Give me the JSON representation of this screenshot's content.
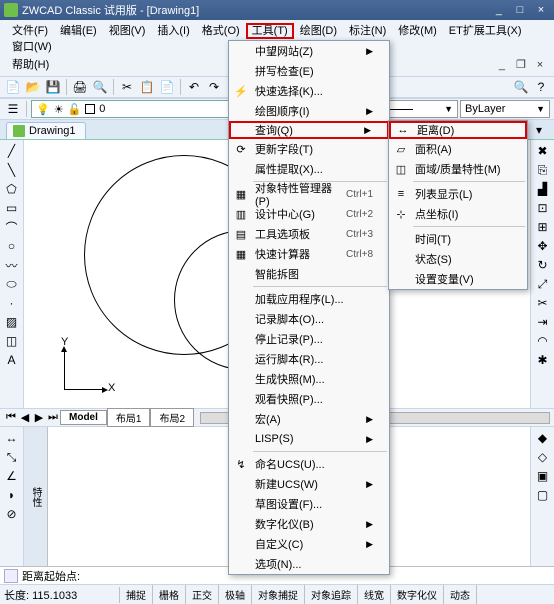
{
  "title": "ZWCAD Classic 试用版 - [Drawing1]",
  "menubar": [
    "文件(F)",
    "编辑(E)",
    "视图(V)",
    "插入(I)",
    "格式(O)",
    "工具(T)",
    "绘图(D)",
    "标注(N)",
    "修改(M)",
    "ET扩展工具(X)",
    "窗口(W)",
    "帮助(H)"
  ],
  "active_menu_index": 5,
  "layer": {
    "name": "0"
  },
  "bylayer": "ByLayer",
  "doctab": "Drawing1",
  "tools_menu": [
    {
      "label": "中望网站(Z)",
      "arrow": true
    },
    {
      "label": "拼写检查(E)"
    },
    {
      "label": "快速选择(K)...",
      "icon": "⚡"
    },
    {
      "label": "绘图顺序(I)",
      "arrow": true
    },
    {
      "label": "查询(Q)",
      "arrow": true,
      "highlight": true
    },
    {
      "label": "更新字段(T)",
      "icon": "⟳"
    },
    {
      "label": "属性提取(X)..."
    },
    {
      "sep": true
    },
    {
      "label": "对象特性管理器(P)",
      "shortcut": "Ctrl+1",
      "icon": "▦"
    },
    {
      "label": "设计中心(G)",
      "shortcut": "Ctrl+2",
      "icon": "▥"
    },
    {
      "label": "工具选项板",
      "shortcut": "Ctrl+3",
      "icon": "▤"
    },
    {
      "label": "快速计算器",
      "shortcut": "Ctrl+8",
      "icon": "▦"
    },
    {
      "label": "智能拆图"
    },
    {
      "sep": true
    },
    {
      "label": "加载应用程序(L)..."
    },
    {
      "label": "记录脚本(O)..."
    },
    {
      "label": "停止记录(P)..."
    },
    {
      "label": "运行脚本(R)..."
    },
    {
      "label": "生成快照(M)..."
    },
    {
      "label": "观看快照(P)..."
    },
    {
      "label": "宏(A)",
      "arrow": true
    },
    {
      "label": "LISP(S)",
      "arrow": true
    },
    {
      "sep": true
    },
    {
      "label": "命名UCS(U)...",
      "icon": "↯"
    },
    {
      "label": "新建UCS(W)",
      "arrow": true
    },
    {
      "label": "草图设置(F)..."
    },
    {
      "label": "数字化仪(B)",
      "arrow": true
    },
    {
      "label": "自定义(C)",
      "arrow": true
    },
    {
      "label": "选项(N)..."
    }
  ],
  "query_submenu": [
    {
      "label": "距离(D)",
      "icon": "↔",
      "highlight": true
    },
    {
      "label": "面积(A)",
      "icon": "▱"
    },
    {
      "label": "面域/质量特性(M)",
      "icon": "◫"
    },
    {
      "sep": true
    },
    {
      "label": "列表显示(L)",
      "icon": "≡"
    },
    {
      "label": "点坐标(I)",
      "icon": "⊹"
    },
    {
      "sep": true
    },
    {
      "label": "时间(T)"
    },
    {
      "label": "状态(S)"
    },
    {
      "label": "设置变量(V)"
    }
  ],
  "ucs": {
    "x": "X",
    "y": "Y"
  },
  "model_tabs": [
    "Model",
    "布局1",
    "布局2"
  ],
  "btab_label": "特性",
  "cmdline": "距离起始点:",
  "coord_label": "长度:",
  "coord_value": "115.1033",
  "status_btns": [
    "捕捉",
    "栅格",
    "正交",
    "极轴",
    "对象捕捉",
    "对象追踪",
    "线宽",
    "数字化仪",
    "动态"
  ],
  "window_btns": {
    "min": "_",
    "max": "□",
    "close": "×"
  },
  "inner_btns": {
    "min": "_",
    "restore": "❐",
    "close": "×"
  }
}
